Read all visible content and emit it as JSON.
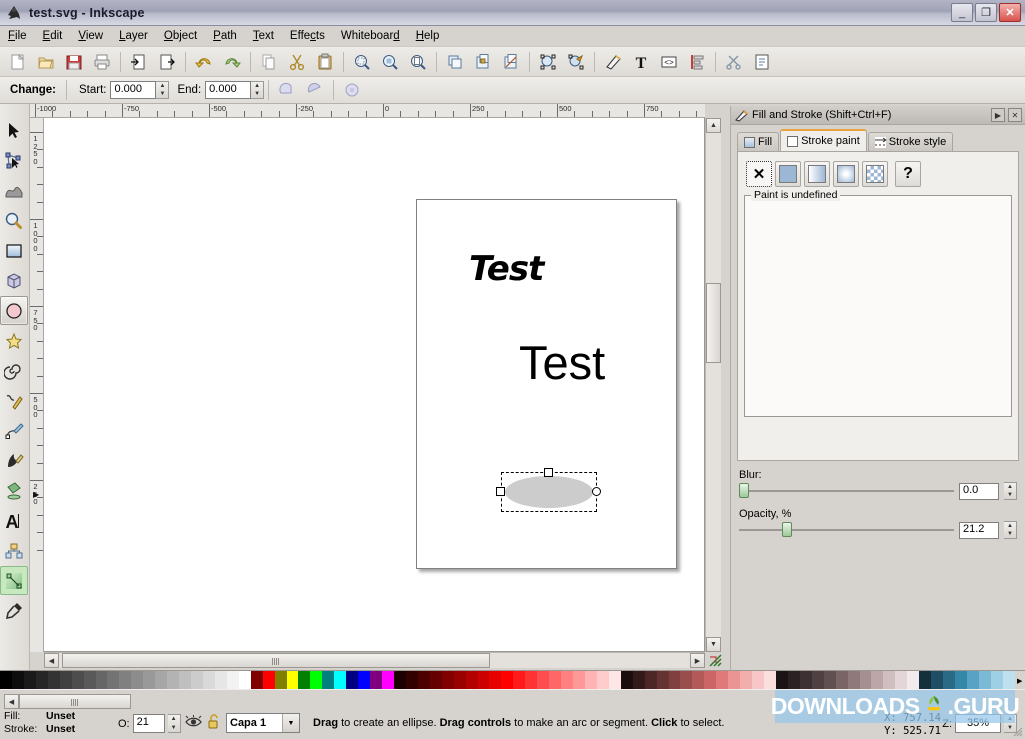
{
  "window": {
    "title": "test.svg - Inkscape",
    "app_icon": "inkscape-icon",
    "minimize_label": "_",
    "maximize_label": "❐",
    "close_label": "✕"
  },
  "menu": {
    "items": [
      {
        "label": "File",
        "accel": "F"
      },
      {
        "label": "Edit",
        "accel": "E"
      },
      {
        "label": "View",
        "accel": "V"
      },
      {
        "label": "Layer",
        "accel": "L"
      },
      {
        "label": "Object",
        "accel": "O"
      },
      {
        "label": "Path",
        "accel": "P"
      },
      {
        "label": "Text",
        "accel": "T"
      },
      {
        "label": "Effects",
        "accel": "c"
      },
      {
        "label": "Whiteboard",
        "accel": "d"
      },
      {
        "label": "Help",
        "accel": "H"
      }
    ]
  },
  "command_toolbar": {
    "buttons": [
      {
        "name": "new-document-icon",
        "title": "New"
      },
      {
        "name": "open-document-icon",
        "title": "Open"
      },
      {
        "name": "save-document-icon",
        "title": "Save"
      },
      {
        "name": "print-document-icon",
        "title": "Print"
      },
      {
        "name": "import-icon",
        "title": "Import"
      },
      {
        "name": "export-icon",
        "title": "Export"
      },
      {
        "name": "undo-icon",
        "title": "Undo"
      },
      {
        "name": "redo-icon",
        "title": "Redo"
      },
      {
        "name": "copy-icon",
        "title": "Copy"
      },
      {
        "name": "cut-icon",
        "title": "Cut"
      },
      {
        "name": "paste-icon",
        "title": "Paste"
      },
      {
        "name": "zoom-selection-icon",
        "title": "Zoom to selection"
      },
      {
        "name": "zoom-drawing-icon",
        "title": "Zoom to drawing"
      },
      {
        "name": "zoom-page-icon",
        "title": "Zoom to page"
      },
      {
        "name": "duplicate-icon",
        "title": "Duplicate"
      },
      {
        "name": "group-icon",
        "title": "Group"
      },
      {
        "name": "ungroup-icon",
        "title": "Ungroup"
      },
      {
        "name": "fill-stroke-dialog-icon",
        "title": "Fill and Stroke"
      },
      {
        "name": "object-properties-icon",
        "title": "Object properties"
      },
      {
        "name": "xml-editor-icon",
        "title": "XML editor"
      },
      {
        "name": "align-distribute-icon",
        "title": "Align and distribute"
      },
      {
        "name": "preferences-icon",
        "title": "Preferences"
      },
      {
        "name": "document-properties-icon",
        "title": "Document properties"
      }
    ]
  },
  "style_indicator": {
    "fill_label": "Fill:",
    "fill_value": "Unset",
    "stroke_label": "Stroke:",
    "stroke_value": "Unset",
    "opacity_abbrev": "O:.2"
  },
  "tool_options": {
    "change_label": "Change:",
    "start_label": "Start:",
    "start_value": "0.000",
    "end_label": "End:",
    "end_value": "0.000",
    "buttons": [
      {
        "name": "arc-segment-icon"
      },
      {
        "name": "arc-chord-icon"
      },
      {
        "name": "whole-ellipse-icon"
      }
    ]
  },
  "toolbox": {
    "tools": [
      {
        "name": "selector-tool",
        "label": "Selector",
        "active": false
      },
      {
        "name": "node-editor-tool",
        "label": "Node editor",
        "active": false
      },
      {
        "name": "tweak-tool",
        "label": "Tweak",
        "active": false
      },
      {
        "name": "zoom-tool",
        "label": "Zoom",
        "active": false
      },
      {
        "name": "rectangle-tool",
        "label": "Rectangle",
        "active": false
      },
      {
        "name": "box3d-tool",
        "label": "3D Box",
        "active": false
      },
      {
        "name": "ellipse-tool",
        "label": "Ellipse",
        "active": true
      },
      {
        "name": "star-tool",
        "label": "Star",
        "active": false
      },
      {
        "name": "spiral-tool",
        "label": "Spiral",
        "active": false
      },
      {
        "name": "pencil-tool",
        "label": "Pencil",
        "active": false
      },
      {
        "name": "bezier-tool",
        "label": "Bezier",
        "active": false
      },
      {
        "name": "calligraphy-tool",
        "label": "Calligraphy",
        "active": false
      },
      {
        "name": "paintbucket-tool",
        "label": "Paint bucket",
        "active": false
      },
      {
        "name": "text-tool",
        "label": "Text",
        "active": false
      },
      {
        "name": "connector-tool",
        "label": "Connector",
        "active": false
      },
      {
        "name": "gradient-tool",
        "label": "Gradient",
        "active": true
      },
      {
        "name": "dropper-tool",
        "label": "Dropper",
        "active": false
      }
    ]
  },
  "rulers": {
    "horizontal_labels": [
      "-1000",
      "-750",
      "-500",
      "-250",
      "0",
      "250",
      "500",
      "750"
    ],
    "vertical_labels": [
      "1250",
      "1000",
      "750",
      "500",
      "250"
    ],
    "units": "px"
  },
  "canvas": {
    "page_objects": [
      {
        "name": "text-object-bold",
        "text": "Test"
      },
      {
        "name": "text-object-plain",
        "text": "Test"
      },
      {
        "name": "ellipse-object",
        "fill": "#cccccc",
        "selected": true
      }
    ]
  },
  "dock": {
    "title": "Fill and Stroke (Shift+Ctrl+F)",
    "title_icon": "fill-stroke-icon",
    "expand_label": "▶",
    "close_label": "✕",
    "tabs": [
      {
        "label": "Fill",
        "icon": "fill-swatch-icon",
        "active": false
      },
      {
        "label": "Stroke paint",
        "icon": "stroke-paint-swatch-icon",
        "active": true
      },
      {
        "label": "Stroke style",
        "icon": "stroke-style-icon",
        "active": false
      }
    ],
    "paint_types": [
      {
        "name": "no-paint-button",
        "glyph": "✕",
        "selected": true
      },
      {
        "name": "flat-color-button"
      },
      {
        "name": "linear-gradient-button"
      },
      {
        "name": "radial-gradient-button"
      },
      {
        "name": "pattern-button"
      },
      {
        "name": "unknown-paint-button",
        "glyph": "?"
      }
    ],
    "paint_status": "Paint is undefined",
    "blur": {
      "label": "Blur:",
      "value": "0.0",
      "percent": 0
    },
    "opacity": {
      "label": "Opacity, %",
      "value": "21.2",
      "percent": 21.2
    }
  },
  "palette": {
    "name": "default-color-palette",
    "left_arrow": "◀",
    "right_arrow": "▶",
    "colors": [
      "#000000",
      "#0d0d0d",
      "#1a1a1a",
      "#262626",
      "#333333",
      "#404040",
      "#4d4d4d",
      "#595959",
      "#666666",
      "#737373",
      "#808080",
      "#8c8c8c",
      "#999999",
      "#a6a6a6",
      "#b3b3b3",
      "#bfbfbf",
      "#cccccc",
      "#d9d9d9",
      "#e6e6e6",
      "#f2f2f2",
      "#ffffff",
      "#800000",
      "#ff0000",
      "#808000",
      "#ffff00",
      "#008000",
      "#00ff00",
      "#008080",
      "#00ffff",
      "#000080",
      "#0000ff",
      "#800080",
      "#ff00ff",
      "#1a0000",
      "#330000",
      "#4d0000",
      "#660000",
      "#800000",
      "#990000",
      "#b30000",
      "#cc0000",
      "#e60000",
      "#ff0000",
      "#ff1a1a",
      "#ff3333",
      "#ff4d4d",
      "#ff6666",
      "#ff8080",
      "#ff9999",
      "#ffb3b3",
      "#ffcccc",
      "#ffe6e6",
      "#1a0d0d",
      "#331a1a",
      "#4d2626",
      "#663333",
      "#804040",
      "#994d4d",
      "#b35959",
      "#cc6666",
      "#e07a7a",
      "#eb9494",
      "#f2adad",
      "#f7c7c7",
      "#fbdede",
      "#1a1416",
      "#2b2224",
      "#3d3133",
      "#4f4042",
      "#615052",
      "#7a6466",
      "#8f797b",
      "#a68f91",
      "#bca6a8",
      "#d1bec0",
      "#e4d6d8",
      "#f2eaec",
      "#14303d",
      "#1f4d63",
      "#2a6a85",
      "#3587a8",
      "#58a3c4",
      "#7bb9d4",
      "#9ecfe3",
      "#bfe0ee"
    ]
  },
  "statusbar": {
    "fill_label": "Fill:",
    "fill_value": "Unset",
    "stroke_label": "Stroke:",
    "stroke_value": "Unset",
    "opacity_label": "O:",
    "opacity_value": "21",
    "visibility_icon": "eye-icon",
    "lock_icon": "unlocked-icon",
    "layer_name": "Capa 1",
    "layer_dropdown_arrow": "▼",
    "message_parts": [
      {
        "text": "Drag",
        "bold": true
      },
      {
        "text": " to create an ellipse. ",
        "bold": false
      },
      {
        "text": "Drag controls",
        "bold": true
      },
      {
        "text": " to make an arc or segment. ",
        "bold": false
      },
      {
        "text": "Click",
        "bold": true
      },
      {
        "text": " to select.",
        "bold": false
      }
    ],
    "cursor_x_label": "X:",
    "cursor_x_value": "757.14",
    "cursor_y_label": "Y:",
    "cursor_y_value": "525.71",
    "zoom_label": "Z:",
    "zoom_value": "35%"
  },
  "watermark": {
    "text_left": "DOWNLOADS",
    "text_right": ".GURU"
  }
}
